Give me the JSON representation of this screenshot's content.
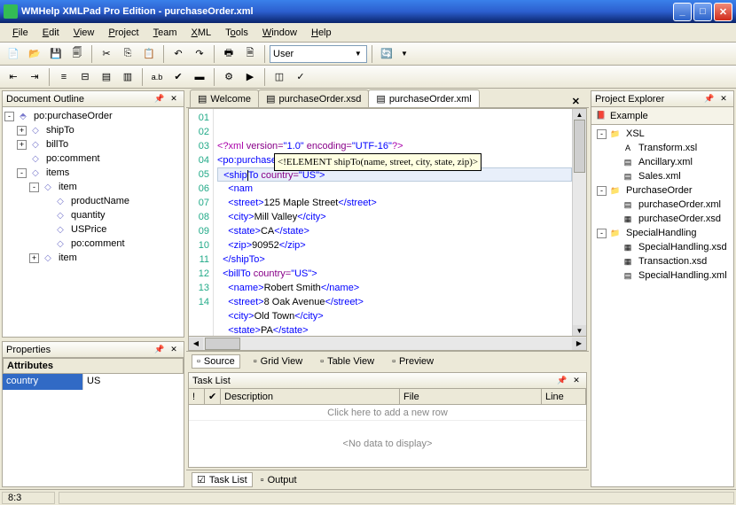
{
  "title": "WMHelp XMLPad Pro Edition - purchaseOrder.xml",
  "menus": [
    "File",
    "Edit",
    "View",
    "Project",
    "Team",
    "XML",
    "Tools",
    "Window",
    "Help"
  ],
  "toolbar2_combo": "User",
  "panels": {
    "outline": "Document Outline",
    "properties": "Properties",
    "project": "Project Explorer",
    "tasklist": "Task List"
  },
  "outline_tree": [
    {
      "d": 0,
      "exp": "-",
      "ic": "⬘",
      "label": "po:purchaseOrder"
    },
    {
      "d": 1,
      "exp": "+",
      "ic": "◇",
      "label": "shipTo"
    },
    {
      "d": 1,
      "exp": "+",
      "ic": "◇",
      "label": "billTo"
    },
    {
      "d": 1,
      "exp": "",
      "ic": "◇",
      "label": "po:comment"
    },
    {
      "d": 1,
      "exp": "-",
      "ic": "◇",
      "label": "items"
    },
    {
      "d": 2,
      "exp": "-",
      "ic": "◇",
      "label": "item"
    },
    {
      "d": 3,
      "exp": "",
      "ic": "◇",
      "label": "productName"
    },
    {
      "d": 3,
      "exp": "",
      "ic": "◇",
      "label": "quantity"
    },
    {
      "d": 3,
      "exp": "",
      "ic": "◇",
      "label": "USPrice"
    },
    {
      "d": 3,
      "exp": "",
      "ic": "◇",
      "label": "po:comment"
    },
    {
      "d": 2,
      "exp": "+",
      "ic": "◇",
      "label": "item"
    }
  ],
  "properties": {
    "header": "Attributes",
    "rows": [
      {
        "k": "country",
        "v": "US"
      }
    ]
  },
  "editor_tabs": [
    {
      "label": "Welcome",
      "active": false
    },
    {
      "label": "purchaseOrder.xsd",
      "active": false
    },
    {
      "label": "purchaseOrder.xml",
      "active": true
    }
  ],
  "code_lines": [
    {
      "n": "01",
      "html": "<span class='decl'>&lt;?xml</span> <span class='attr'>version=</span><span class='str'>\"1.0\"</span> <span class='attr'>encoding=</span><span class='str'>\"UTF-16\"</span><span class='decl'>?&gt;</span>"
    },
    {
      "n": "02",
      "html": "<span class='kw'>&lt;po:purchaseOrder</span> <span class='attr'>orderDate=</span><span class='str'>\"2001-01-01\"</span> <span class='ns'>xmlns</span>"
    },
    {
      "n": "03",
      "html": "  <span class='kw'>&lt;ship</span><span style='border-left:1px solid #000'></span><span class='kw'>To</span> <span class='attr'>country=</span><span class='str'>\"US\"</span><span class='kw'>&gt;</span>",
      "hl": true
    },
    {
      "n": "04",
      "html": "    <span class='kw'>&lt;nam</span>"
    },
    {
      "n": "05",
      "html": "    <span class='kw'>&lt;street&gt;</span>125 Maple Street<span class='kw'>&lt;/street&gt;</span>"
    },
    {
      "n": "06",
      "html": "    <span class='kw'>&lt;city&gt;</span>Mill Valley<span class='kw'>&lt;/city&gt;</span>"
    },
    {
      "n": "07",
      "html": "    <span class='kw'>&lt;state&gt;</span>CA<span class='kw'>&lt;/state&gt;</span>"
    },
    {
      "n": "08",
      "html": "    <span class='kw'>&lt;zip&gt;</span>90952<span class='kw'>&lt;/zip&gt;</span>"
    },
    {
      "n": "09",
      "html": "  <span class='kw'>&lt;/shipTo&gt;</span>"
    },
    {
      "n": "10",
      "html": "  <span class='kw'>&lt;billTo</span> <span class='attr'>country=</span><span class='str'>\"US\"</span><span class='kw'>&gt;</span>"
    },
    {
      "n": "11",
      "html": "    <span class='kw'>&lt;name&gt;</span>Robert Smith<span class='kw'>&lt;/name&gt;</span>"
    },
    {
      "n": "12",
      "html": "    <span class='kw'>&lt;street&gt;</span>8 Oak Avenue<span class='kw'>&lt;/street&gt;</span>"
    },
    {
      "n": "13",
      "html": "    <span class='kw'>&lt;city&gt;</span>Old Town<span class='kw'>&lt;/city&gt;</span>"
    },
    {
      "n": "14",
      "html": "    <span class='kw'>&lt;state&gt;</span>PA<span class='kw'>&lt;/state&gt;</span>"
    }
  ],
  "code_hint": "<!ELEMENT shipTo(name, street, city, state, zip)>",
  "view_tabs": [
    "Source",
    "Grid View",
    "Table View",
    "Preview"
  ],
  "project_root": "Example",
  "project_tree": [
    {
      "d": 0,
      "exp": "-",
      "ic": "📁",
      "label": "XSL"
    },
    {
      "d": 1,
      "exp": "",
      "ic": "A",
      "label": "Transform.xsl"
    },
    {
      "d": 1,
      "exp": "",
      "ic": "▤",
      "label": "Ancillary.xml"
    },
    {
      "d": 1,
      "exp": "",
      "ic": "▤",
      "label": "Sales.xml"
    },
    {
      "d": 0,
      "exp": "-",
      "ic": "📁",
      "label": "PurchaseOrder"
    },
    {
      "d": 1,
      "exp": "",
      "ic": "▤",
      "label": "purchaseOrder.xml"
    },
    {
      "d": 1,
      "exp": "",
      "ic": "▦",
      "label": "purchaseOrder.xsd"
    },
    {
      "d": 0,
      "exp": "-",
      "ic": "📁",
      "label": "SpecialHandling"
    },
    {
      "d": 1,
      "exp": "",
      "ic": "▦",
      "label": "SpecialHandling.xsd"
    },
    {
      "d": 1,
      "exp": "",
      "ic": "▦",
      "label": "Transaction.xsd"
    },
    {
      "d": 1,
      "exp": "",
      "ic": "▤",
      "label": "SpecialHandling.xml"
    }
  ],
  "task_columns": [
    "!",
    "✔",
    "Description",
    "File",
    "Line"
  ],
  "task_addrow": "Click here to add a new row",
  "task_empty": "<No data to display>",
  "bottom_tabs": [
    "Task List",
    "Output"
  ],
  "status_pos": "8:3"
}
